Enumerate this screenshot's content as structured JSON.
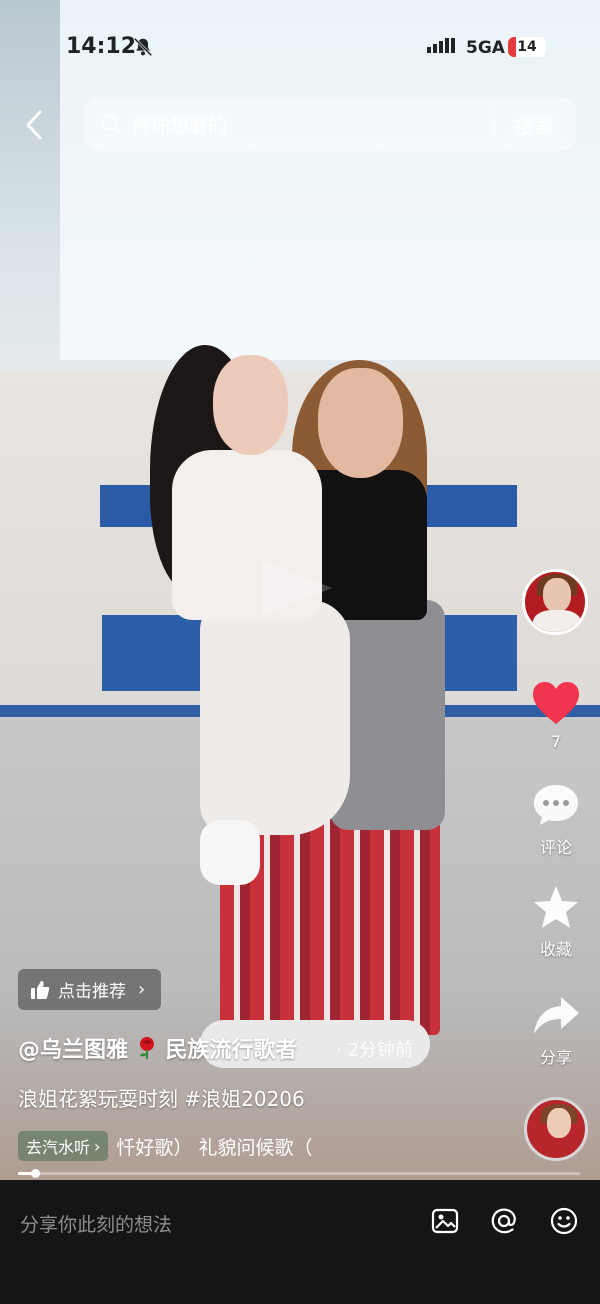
{
  "status_bar": {
    "time": "14:12",
    "network": "5GA",
    "battery": "14"
  },
  "search": {
    "placeholder": "搜你想看的",
    "button_label": "搜索"
  },
  "rail": {
    "like_count": "7",
    "comment_label": "评论",
    "favorite_label": "收藏",
    "share_label": "分享",
    "colors": {
      "like": "#f2344f"
    }
  },
  "caption": {
    "recommend_label": "点击推荐",
    "author": "@乌兰图雅",
    "author_suffix": "民族流行歌者",
    "time_ago": "· 2分钟前",
    "description": "浪姐花絮玩耍时刻 #浪姐20206",
    "car_listen": "去汽水听",
    "song": "忏好歌）    礼貌问候歌（",
    "progress": 0.03
  },
  "bottom_bar": {
    "comment_placeholder": "分享你此刻的想法"
  },
  "icons": [
    "back-icon",
    "search-icon",
    "like-icon",
    "comment-icon",
    "star-icon",
    "share-icon",
    "thumb-icon",
    "image-icon",
    "at-icon",
    "emoji-icon",
    "rose-icon"
  ]
}
